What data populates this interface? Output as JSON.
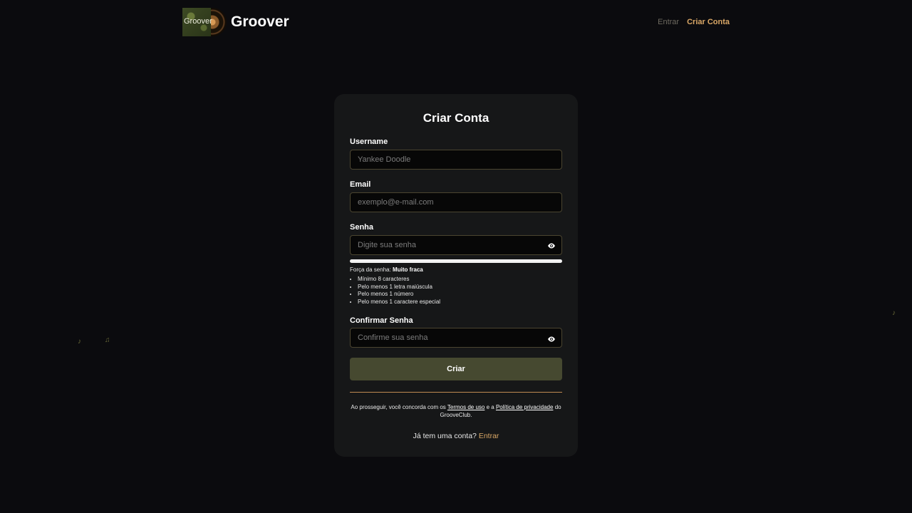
{
  "header": {
    "logo_text": "Groover",
    "brand": "Groover",
    "nav": {
      "entrar": "Entrar",
      "criar_conta": "Criar Conta"
    }
  },
  "form": {
    "title": "Criar Conta",
    "username": {
      "label": "Username",
      "placeholder": "Yankee Doodle"
    },
    "email": {
      "label": "Email",
      "placeholder": "exemplo@e-mail.com"
    },
    "senha": {
      "label": "Senha",
      "placeholder": "Digite sua senha",
      "toggle_icon": "eye-icon"
    },
    "strength": {
      "label": "Força da senha:",
      "value": "Muito fraca",
      "rules": [
        "Mínimo 8 caracteres",
        "Pelo menos 1 letra maiúscula",
        "Pelo menos 1 número",
        "Pelo menos 1 caractere especial"
      ]
    },
    "confirmar": {
      "label": "Confirmar Senha",
      "placeholder": "Confirme sua senha",
      "toggle_icon": "eye-icon"
    },
    "submit_label": "Criar",
    "terms": {
      "prefix": "Ao prosseguir, você concorda com os",
      "terms_link": "Termos de uso",
      "middle": "e a",
      "privacy_link": "Política de privacidade",
      "suffix": "do GrooveClub."
    },
    "login": {
      "prompt": "Já tem uma conta?",
      "link": "Entrar"
    }
  },
  "colors": {
    "background": "#0b0b0e",
    "card": "#161718",
    "accent": "#d9a766",
    "button": "#464930",
    "input_border": "#4b4530"
  }
}
